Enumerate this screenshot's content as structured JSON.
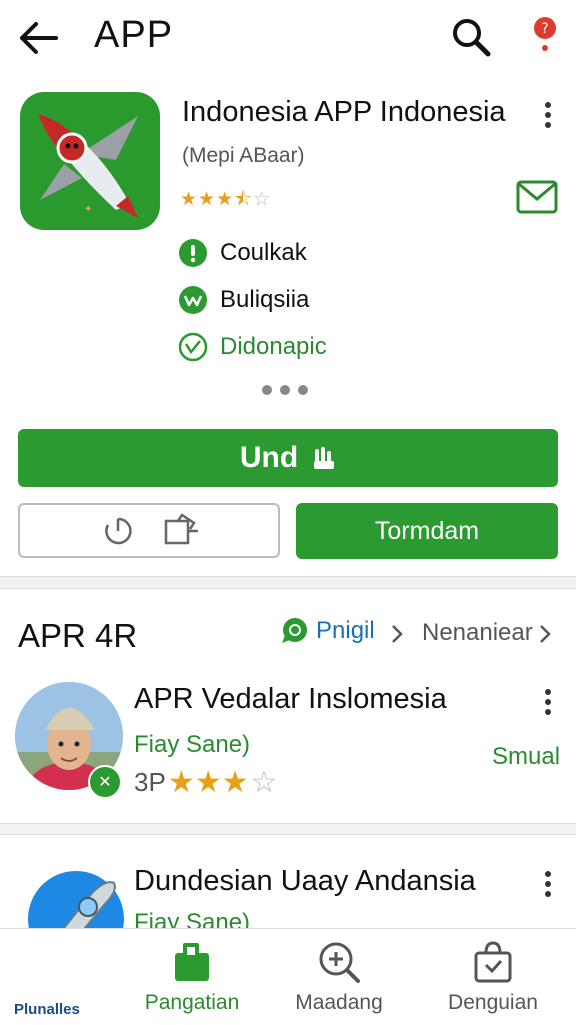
{
  "header": {
    "title": "APP"
  },
  "app": {
    "name": "Indonesia APP Indonesia",
    "subtitle": "(Mepi ABaar)",
    "rating": 3.5,
    "rating_stars": "★★★⯪☆",
    "features": [
      {
        "icon": "exclamation-icon",
        "label": "Coulkak"
      },
      {
        "icon": "w-badge-icon",
        "label": "Buliqsiia"
      },
      {
        "icon": "shield-check-icon",
        "label": "Didonapic"
      }
    ],
    "primary_button": "Und",
    "secondary_button": "Tormdam"
  },
  "section": {
    "title": "APR 4R",
    "link1": "Pnigil",
    "link2": "Nenaniear",
    "review": {
      "title": "APR Vedalar Inslomesia",
      "subtitle": "Fiay Sane)",
      "action": "Smual",
      "rating_prefix": "3P",
      "rating": 3,
      "stars_filled": "★★★",
      "stars_empty": "☆"
    }
  },
  "second_item": {
    "title": "Dundesian Uaay Andansia",
    "subtitle": "Fiay Sane)"
  },
  "bottom_nav": {
    "items": [
      {
        "label": "Plunalles",
        "icon": "rocket-icon"
      },
      {
        "label": "Pangatian",
        "icon": "bag-icon"
      },
      {
        "label": "Maadang",
        "icon": "zoom-in-icon"
      },
      {
        "label": "Denguian",
        "icon": "shopping-bag-icon"
      }
    ]
  },
  "colors": {
    "brand_green": "#2b9a31",
    "link_blue": "#1a6fb5",
    "star": "#e6a11a"
  }
}
